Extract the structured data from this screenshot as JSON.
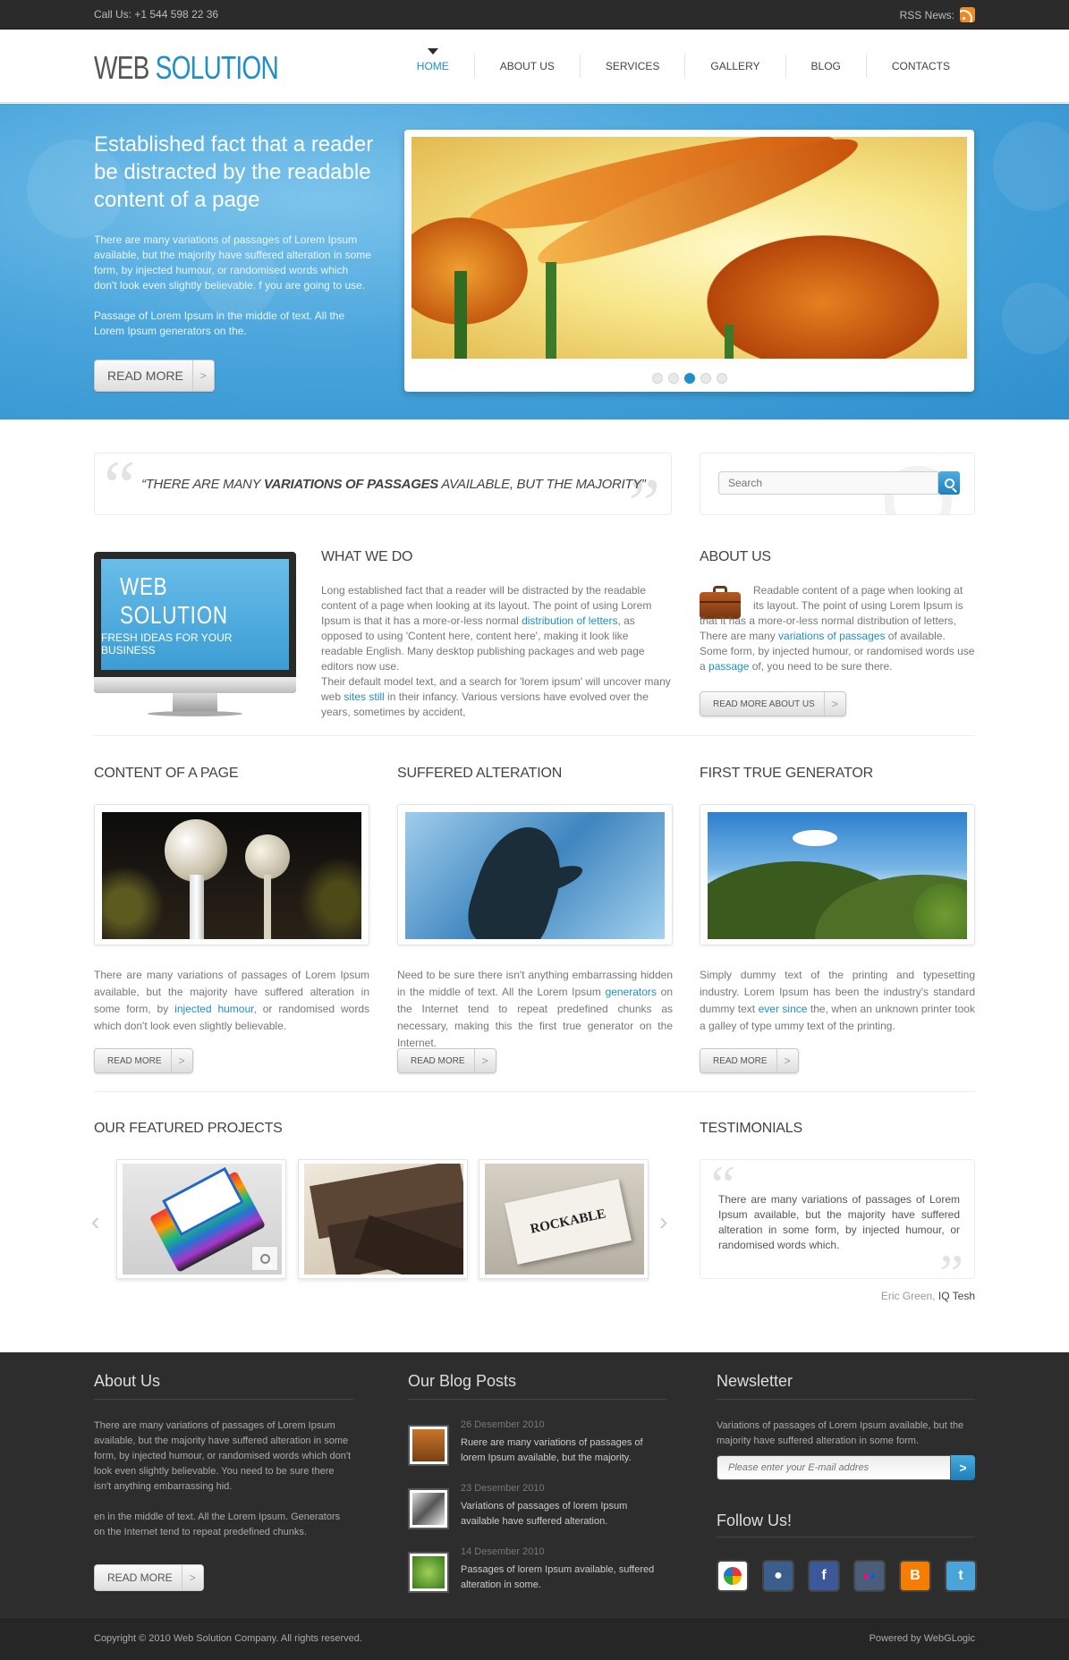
{
  "topbar": {
    "call": "Call Us: +1 544 598 22 36",
    "rss_label": "RSS News:",
    "rss_icon": "rss-icon"
  },
  "header": {
    "logo_word1": "WEB",
    "logo_word2": "SOLUTION",
    "nav": [
      {
        "label": "HOME",
        "active": true
      },
      {
        "label": "ABOUT US",
        "active": false
      },
      {
        "label": "SERVICES",
        "active": false
      },
      {
        "label": "GALLERY",
        "active": false
      },
      {
        "label": "BLOG",
        "active": false
      },
      {
        "label": "CONTACTS",
        "active": false
      }
    ]
  },
  "hero": {
    "title": "Established fact that a reader be distracted by the readable content of a page",
    "p1": "There are many variations of passages of Lorem Ipsum available, but the majority have suffered alteration in some form, by injected humour, or randomised words which don't look even slightly believable. f you are going to use.",
    "p2": "Passage of Lorem Ipsum in the middle of text. All the Lorem Ipsum generators on the.",
    "button": "READ MORE",
    "slider_active_dot": 3
  },
  "quote": {
    "pre": "“THERE ARE MANY ",
    "bold": "VARIATIONS OF PASSAGES",
    "post": " AVAILABLE, BUT THE MAJORITY”"
  },
  "search": {
    "placeholder": "Search",
    "icon": "search-icon"
  },
  "what_we_do": {
    "title": "WHAT WE DO",
    "monitor_title": "WEB SOLUTION",
    "monitor_sub": "FRESH IDEAS FOR YOUR BUSINESS",
    "p1a": "Long established fact that a reader will be distracted by the readable content of a page when looking at its layout. The point of using Lorem Ipsum is that it has a more-or-less normal ",
    "p1link": "distribution of letters",
    "p1b": ", as opposed to using 'Content here, content here', making it look like readable English. Many desktop publishing packages and web page editors now use.",
    "p2a": "Their default model text, and a search for 'lorem ipsum' will uncover many web ",
    "p2link": "sites still",
    "p2b": " in their infancy. Various versions have evolved over the years, sometimes by accident,"
  },
  "about_us": {
    "title": "ABOUT US",
    "p_a": "Readable content of a page when looking at its layout. The point of using Lorem Ipsum is that it has a more-or-less normal distribution of letters, There are many ",
    "link1": "variations of passages",
    "p_b": " of available. Some form, by injected humour, or randomised words use a ",
    "link2": "passage",
    "p_c": " of, you need to be sure there.",
    "button": "READ MORE ABOUT US"
  },
  "columns": [
    {
      "title": "CONTENT OF A PAGE",
      "a": "There are many variations of passages of Lorem Ipsum available, but the majority have suffered alteration in some form, by ",
      "link": "injected humour",
      "b": ", or randomised words which don't look even slightly believable.",
      "button": "READ MORE"
    },
    {
      "title": "SUFFERED ALTERATION",
      "a": "Need to be sure there isn't anything embarrassing hidden in the middle of text. All the Lorem Ipsum ",
      "link": "generators",
      "b": " on the Internet tend to repeat predefined chunks as necessary, making this the first true generator on the Internet.",
      "button": "READ MORE"
    },
    {
      "title": "FIRST TRUE GENERATOR",
      "a": "Simply dummy text of the printing and typesetting industry. Lorem Ipsum has been the industry's standard dummy text ",
      "link": "ever since",
      "b": " the, when an unknown printer took a galley of type ummy text of the printing.",
      "button": "READ MORE"
    }
  ],
  "featured": {
    "title": "OUR FEATURED PROJECTS",
    "card3_text": "ROCKABLE"
  },
  "testimonials": {
    "title": "TESTIMONIALS",
    "text": "There are many variations of passages of Lorem Ipsum available, but the majority have suffered alteration in some form, by injected humour, or randomised words which.",
    "author": "Eric Green,",
    "company": "IQ Tesh"
  },
  "footer": {
    "about_title": "About Us",
    "about_p1": "There are many variations of passages of Lorem Ipsum available, but the majority have suffered alteration in some form, by injected humour, or randomised words which don't look even slightly believable. You need to be sure there isn't anything embarrassing hid.",
    "about_p2": "en in the middle of text. All the Lorem Ipsum. Generators on the Internet tend to repeat predefined chunks.",
    "about_button": "READ MORE",
    "blog_title": "Our Blog Posts",
    "posts": [
      {
        "date": "26 Desember 2010",
        "text": "Ruere are many variations of passages of lorem Ipsum available, but the majority."
      },
      {
        "date": "23 Desember 2010",
        "text": "Variations of passages of lorem Ipsum available have suffered alteration."
      },
      {
        "date": "14 Desember 2010",
        "text": "Passages of lorem Ipsum available, suffered alteration in some."
      }
    ],
    "newsletter_title": "Newsletter",
    "newsletter_text": "Variations of passages of Lorem Ipsum available, but the majority have suffered alteration in some form.",
    "email_placeholder": "Please enter your E-mail addres",
    "follow_title": "Follow Us!",
    "social": [
      "picasa-icon",
      "myspace-icon",
      "facebook-icon",
      "flickr-icon",
      "blogger-icon",
      "twitter-icon"
    ]
  },
  "bottom": {
    "copyright": "Copyright © 2010 Web Solution Company. All rights reserved.",
    "powered": "Powered by WebGLogic"
  }
}
